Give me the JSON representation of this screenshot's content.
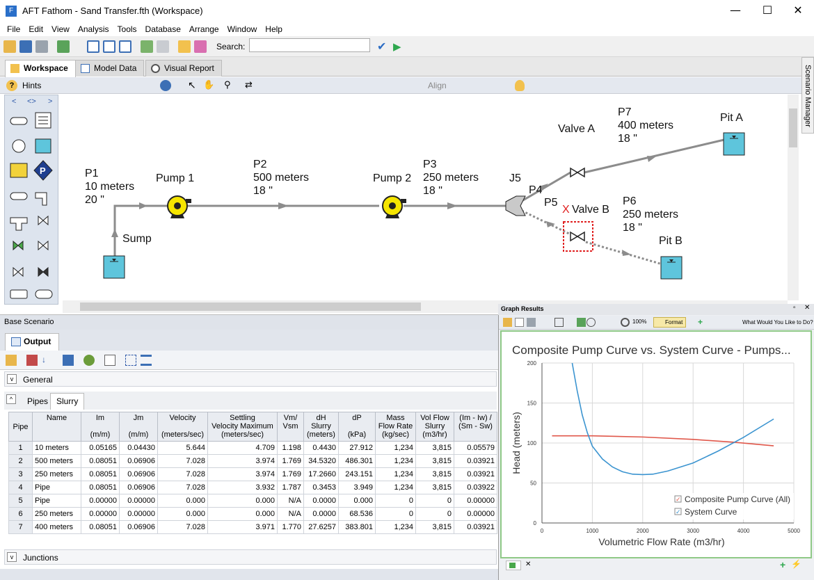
{
  "window": {
    "title": "AFT Fathom - Sand Transfer.fth (Workspace)",
    "minimize": "—",
    "maximize": "☐",
    "close": "✕"
  },
  "menu": [
    "File",
    "Edit",
    "View",
    "Analysis",
    "Tools",
    "Database",
    "Arrange",
    "Window",
    "Help"
  ],
  "toolbar": {
    "search_label": "Search:",
    "search_value": ""
  },
  "tabs": [
    {
      "label": "Workspace"
    },
    {
      "label": "Model Data"
    },
    {
      "label": "Visual Report"
    }
  ],
  "side_tab": "Scenario Manager",
  "toolbar2": {
    "hints": "Hints",
    "align": "Align"
  },
  "palette_nav": [
    "<",
    "<>",
    ">"
  ],
  "workspace": {
    "labels": {
      "p1": "P1\n10 meters\n20 \"",
      "sump": "Sump",
      "pump1": "Pump 1",
      "p2": "P2\n500 meters\n18 \"",
      "pump2": "Pump 2",
      "p3": "P3\n250 meters\n18 \"",
      "j5": "J5",
      "p4": "P4",
      "p5": "P5",
      "valveA": "Valve A",
      "valveB": "Valve B",
      "valveB_mark": "X",
      "p7": "P7\n400 meters\n18 \"",
      "pitA": "Pit A",
      "p6": "P6\n250 meters\n18 \"",
      "pitB": "Pit B"
    },
    "colors": {
      "pipe": "#8c8c8c",
      "pump": "#f5e500",
      "tank": "#5ec5dc",
      "pump_icon_bg": "#1f3f8f"
    }
  },
  "scenario": "Base Scenario",
  "output": {
    "tab": "Output",
    "sections": {
      "general": "General",
      "junctions": "Junctions"
    },
    "subtabs": [
      "Pipes",
      "Slurry"
    ],
    "headers": [
      {
        "top": "Pipe",
        "unit": ""
      },
      {
        "top": "Name",
        "unit": ""
      },
      {
        "top": "Im",
        "unit": "(m/m)"
      },
      {
        "top": "Jm",
        "unit": "(m/m)"
      },
      {
        "top": "Velocity",
        "unit": "(meters/sec)"
      },
      {
        "top": "Settling\nVelocity Maximum",
        "unit": "(meters/sec)"
      },
      {
        "top": "Vm/\nVsm",
        "unit": ""
      },
      {
        "top": "dH\nSlurry",
        "unit": "(meters)"
      },
      {
        "top": "dP",
        "unit": "(kPa)"
      },
      {
        "top": "Mass\nFlow Rate",
        "unit": "(kg/sec)"
      },
      {
        "top": "Vol Flow\nSlurry",
        "unit": "(m3/hr)"
      },
      {
        "top": "(Im - Iw) /\n(Sm - Sw)",
        "unit": ""
      }
    ],
    "rows": [
      [
        "1",
        "10 meters",
        "0.05165",
        "0.04430",
        "5.644",
        "4.709",
        "1.198",
        "0.4430",
        "27.912",
        "1,234",
        "3,815",
        "0.05579"
      ],
      [
        "2",
        "500 meters",
        "0.08051",
        "0.06906",
        "7.028",
        "3.974",
        "1.769",
        "34.5320",
        "486.301",
        "1,234",
        "3,815",
        "0.03921"
      ],
      [
        "3",
        "250 meters",
        "0.08051",
        "0.06906",
        "7.028",
        "3.974",
        "1.769",
        "17.2660",
        "243.151",
        "1,234",
        "3,815",
        "0.03921"
      ],
      [
        "4",
        "Pipe",
        "0.08051",
        "0.06906",
        "7.028",
        "3.932",
        "1.787",
        "0.3453",
        "3.949",
        "1,234",
        "3,815",
        "0.03922"
      ],
      [
        "5",
        "Pipe",
        "0.00000",
        "0.00000",
        "0.000",
        "0.000",
        "N/A",
        "0.0000",
        "0.000",
        "0",
        "0",
        "0.00000"
      ],
      [
        "6",
        "250 meters",
        "0.00000",
        "0.00000",
        "0.000",
        "0.000",
        "N/A",
        "0.0000",
        "68.536",
        "0",
        "0",
        "0.00000"
      ],
      [
        "7",
        "400 meters",
        "0.08051",
        "0.06906",
        "7.028",
        "3.971",
        "1.770",
        "27.6257",
        "383.801",
        "1,234",
        "3,815",
        "0.03921"
      ]
    ]
  },
  "graph_window": {
    "title": "Graph Results",
    "format_btn": "Format",
    "zoom": "100%",
    "help_link": "What Would You Like to Do?"
  },
  "chart_data": {
    "type": "line",
    "title": "Composite Pump Curve vs. System Curve - Pumps...",
    "xlabel": "Volumetric Flow Rate (m3/hr)",
    "ylabel": "Head (meters)",
    "xlim": [
      0,
      5000
    ],
    "ylim": [
      0,
      200
    ],
    "xticks": [
      "0",
      "1000",
      "2000",
      "3000",
      "4000",
      "5000"
    ],
    "yticks": [
      "0",
      "50",
      "100",
      "150",
      "200"
    ],
    "grid": true,
    "legend_position": "bottom-right",
    "series": [
      {
        "name": "Composite Pump Curve (All)",
        "color": "#e0574a",
        "x": [
          200,
          1000,
          2000,
          3000,
          3800,
          4600
        ],
        "y": [
          109,
          109,
          107.5,
          104.5,
          101,
          96.5
        ]
      },
      {
        "name": "System Curve",
        "color": "#3b94d0",
        "x": [
          600,
          700,
          800,
          900,
          1000,
          1200,
          1400,
          1600,
          1800,
          2000,
          2200,
          2500,
          3000,
          3500,
          4000,
          4600
        ],
        "y": [
          200,
          165,
          135,
          113,
          96,
          80,
          70,
          64,
          61,
          60.5,
          61,
          65,
          75,
          90,
          107,
          130
        ]
      }
    ]
  }
}
